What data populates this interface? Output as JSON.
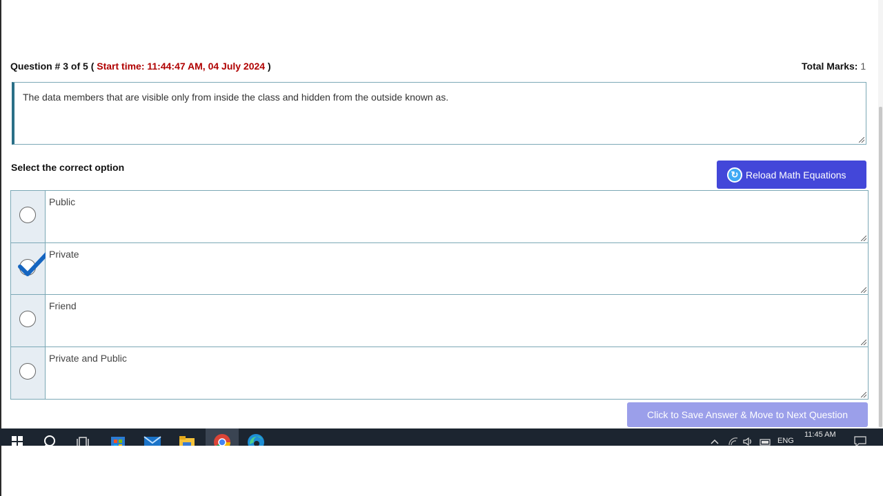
{
  "question": {
    "header_prefix": "Question # 3 of 5 (",
    "start_time": "Start time: 11:44:47 AM, 04 July 2024",
    "header_suffix": ")",
    "total_marks_label": "Total Marks:",
    "total_marks_value": "1",
    "text": "The data members that are visible only from inside the class and hidden from the outside known as."
  },
  "select_label": "Select the correct option",
  "reload_button_label": "Reload Math Equations",
  "options": [
    {
      "label": "Public",
      "selected": false
    },
    {
      "label": "Private",
      "selected": true
    },
    {
      "label": "Friend",
      "selected": false
    },
    {
      "label": "Private and Public",
      "selected": false
    }
  ],
  "save_button_label": "Click to Save Answer & Move to Next Question",
  "taskbar": {
    "time": "11:45 AM",
    "language": "ENG"
  },
  "colors": {
    "accent_button": "#4347d9",
    "save_button": "#9b9fea",
    "start_time": "#b00000",
    "checkmark": "#1565c0"
  }
}
